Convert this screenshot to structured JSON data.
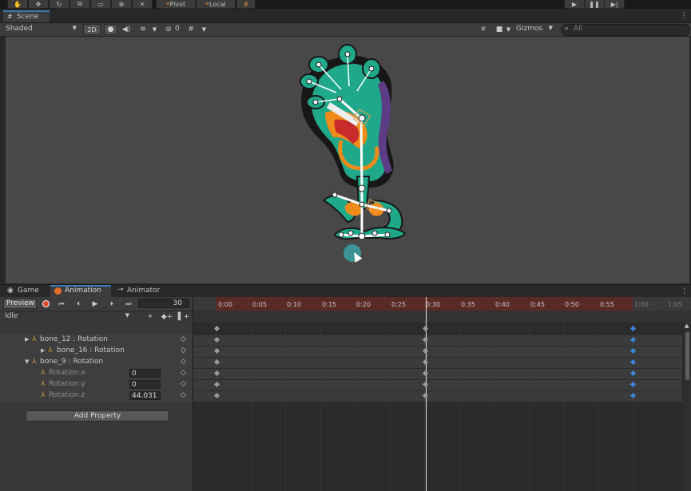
{
  "toolbar": {
    "pivot_label": "Pivot",
    "local_label": "Local",
    "tools": [
      "hand-tool-icon",
      "move-tool-icon",
      "rotate-tool-icon",
      "scale-tool-icon",
      "rect-tool-icon",
      "transform-tool-icon",
      "custom-tool-icon"
    ]
  },
  "scene": {
    "tab_label": "Scene",
    "draw_mode": "Shaded",
    "mode_2d": "2D",
    "hidden_count": "0",
    "gizmos_label": "Gizmos",
    "search_placeholder": "All"
  },
  "bottom_tabs": {
    "game": "Game",
    "animation": "Animation",
    "animator": "Animator"
  },
  "animation": {
    "preview_label": "Preview",
    "frame_value": "30",
    "clip_name": "Idle",
    "add_property_label": "Add Property",
    "properties": [
      {
        "label": "bone_12 : Rotation",
        "expanded": false
      },
      {
        "label": "bone_16 : Rotation",
        "expanded": false
      },
      {
        "label": "bone_9 : Rotation",
        "expanded": true
      },
      {
        "label": "Rotation.x",
        "value": "0"
      },
      {
        "label": "Rotation.y",
        "value": "0"
      },
      {
        "label": "Rotation.z",
        "value": "44.031"
      }
    ],
    "timeline_ticks": [
      "0:00",
      "0:05",
      "0:10",
      "0:15",
      "0:20",
      "0:25",
      "0:30",
      "0:35",
      "0:40",
      "0:45",
      "0:50",
      "0:55",
      "1:00",
      "1:05"
    ]
  },
  "colors": {
    "record_red": "#d9482b",
    "timeline_red": "#5a2b26",
    "keyframe_blue": "#3c86de",
    "accent_teal": "#1fa98a"
  }
}
